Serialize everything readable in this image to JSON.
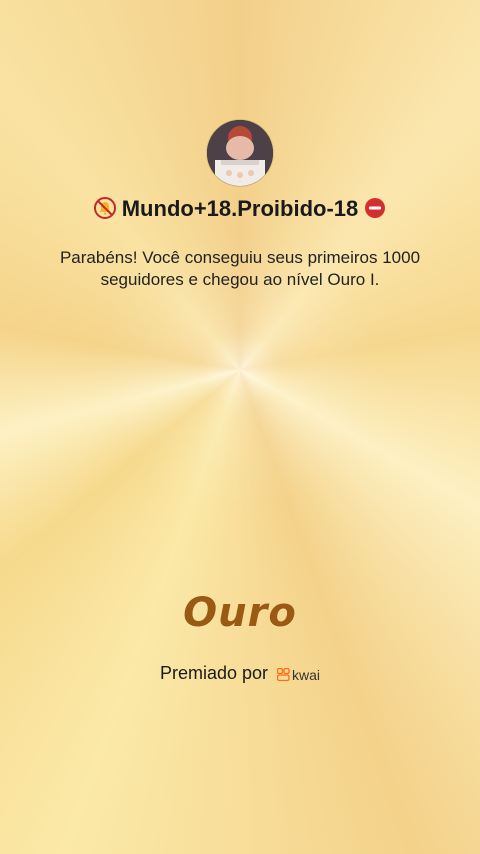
{
  "profile": {
    "username_prefix_icon": "no-bell-icon",
    "username": "Mundo+18.Proibido-18",
    "username_suffix_icon": "no-entry-icon",
    "avatar_icon": "avatar"
  },
  "message": "Parabéns! Você conseguiu seus primeiros 1000 seguidores e chegou ao nível Ouro I.",
  "level_name": "Ouro",
  "awarded_by": {
    "label": "Premiado por",
    "brand_icon": "kwai-logo-icon",
    "brand_name": "kwai"
  },
  "colors": {
    "background": "#f4d98a",
    "level_text": "#9a5a14",
    "brand_orange": "#ff6a1a"
  }
}
